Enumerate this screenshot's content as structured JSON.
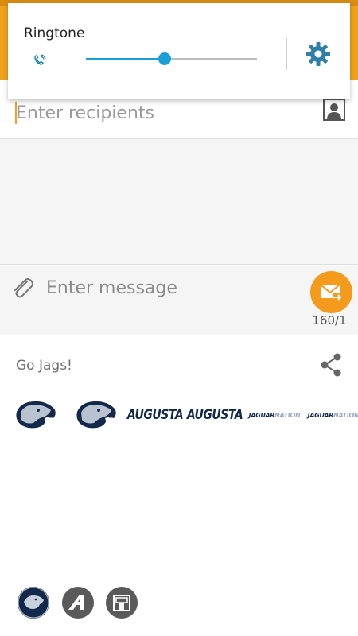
{
  "volume_panel": {
    "title": "Ringtone",
    "level": 0.46,
    "icon": "phone-ring-icon",
    "settings_icon": "gear-icon",
    "accent_color": "#1a9fd6"
  },
  "recipients": {
    "placeholder": "Enter recipients",
    "contact_icon": "contact-icon"
  },
  "compose": {
    "placeholder": "Enter message",
    "attach_icon": "paperclip-icon",
    "send_icon": "send-mms-icon",
    "char_count": "160/1"
  },
  "sticker_pack": {
    "title": "Go Jags!",
    "share_icon": "share-icon",
    "stickers": [
      {
        "name": "jaguar-head-sticker"
      },
      {
        "name": "jaguar-head-sticker"
      },
      {
        "name": "augusta-wordmark-sticker",
        "text": "AUGUSTA"
      },
      {
        "name": "augusta-wordmark-sticker",
        "text": "AUGUSTA"
      },
      {
        "name": "jaguar-nation-sticker",
        "text": "JAGUAR",
        "text2": "NATION"
      },
      {
        "name": "jaguar-nation-sticker",
        "text": "JAGUAR",
        "text2": "NATION"
      }
    ],
    "tabs": [
      {
        "name": "tab-jaguar-pack"
      },
      {
        "name": "tab-a-logo-pack"
      },
      {
        "name": "tab-building-pack"
      }
    ]
  },
  "colors": {
    "app_bar": "#f0a21e",
    "send_button": "#f49b1d",
    "navy": "#13294b"
  }
}
